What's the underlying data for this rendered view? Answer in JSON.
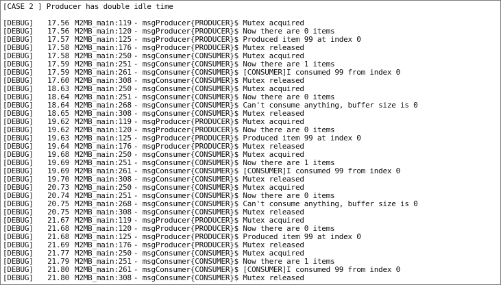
{
  "header": {
    "title": "[CASE 2 ] Producer has double idle time"
  },
  "log": [
    {
      "level": "[DEBUG]",
      "time": "17.56",
      "source": "M2MB_main:119",
      "message": "- msgProducer{PRODUCER}$ Mutex acquired"
    },
    {
      "level": "[DEBUG]",
      "time": "17.56",
      "source": "M2MB_main:120",
      "message": "- msgProducer{PRODUCER}$ Now there are 0 items"
    },
    {
      "level": "[DEBUG]",
      "time": "17.57",
      "source": "M2MB_main:125",
      "message": "- msgProducer{PRODUCER}$ Produced item 99 at index 0"
    },
    {
      "level": "[DEBUG]",
      "time": "17.58",
      "source": "M2MB_main:176",
      "message": "- msgProducer{PRODUCER}$ Mutex released"
    },
    {
      "level": "[DEBUG]",
      "time": "17.58",
      "source": "M2MB_main:250",
      "message": "- msgConsumer{CONSUMER}$ Mutex acquired"
    },
    {
      "level": "[DEBUG]",
      "time": "17.59",
      "source": "M2MB_main:251",
      "message": "- msgConsumer{CONSUMER}$ Now there are 1 items"
    },
    {
      "level": "[DEBUG]",
      "time": "17.59",
      "source": "M2MB_main:261",
      "message": "- msgConsumer{CONSUMER}$ [CONSUMER]I consumed 99 from index 0"
    },
    {
      "level": "[DEBUG]",
      "time": "17.60",
      "source": "M2MB_main:308",
      "message": "- msgConsumer{CONSUMER}$ Mutex released"
    },
    {
      "level": "[DEBUG]",
      "time": "18.63",
      "source": "M2MB_main:250",
      "message": "- msgConsumer{CONSUMER}$ Mutex acquired"
    },
    {
      "level": "[DEBUG]",
      "time": "18.64",
      "source": "M2MB_main:251",
      "message": "- msgConsumer{CONSUMER}$ Now there are 0 items"
    },
    {
      "level": "[DEBUG]",
      "time": "18.64",
      "source": "M2MB_main:268",
      "message": "- msgConsumer{CONSUMER}$ Can't consume anything, buffer size is 0"
    },
    {
      "level": "[DEBUG]",
      "time": "18.65",
      "source": "M2MB_main:308",
      "message": "- msgConsumer{CONSUMER}$ Mutex released"
    },
    {
      "level": "[DEBUG]",
      "time": "19.62",
      "source": "M2MB_main:119",
      "message": "- msgProducer{PRODUCER}$ Mutex acquired"
    },
    {
      "level": "[DEBUG]",
      "time": "19.62",
      "source": "M2MB_main:120",
      "message": "- msgProducer{PRODUCER}$ Now there are 0 items"
    },
    {
      "level": "[DEBUG]",
      "time": "19.63",
      "source": "M2MB_main:125",
      "message": "- msgProducer{PRODUCER}$ Produced item 99 at index 0"
    },
    {
      "level": "[DEBUG]",
      "time": "19.64",
      "source": "M2MB_main:176",
      "message": "- msgProducer{PRODUCER}$ Mutex released"
    },
    {
      "level": "[DEBUG]",
      "time": "19.68",
      "source": "M2MB_main:250",
      "message": "- msgConsumer{CONSUMER}$ Mutex acquired"
    },
    {
      "level": "[DEBUG]",
      "time": "19.69",
      "source": "M2MB_main:251",
      "message": "- msgConsumer{CONSUMER}$ Now there are 1 items"
    },
    {
      "level": "[DEBUG]",
      "time": "19.69",
      "source": "M2MB_main:261",
      "message": "- msgConsumer{CONSUMER}$ [CONSUMER]I consumed 99 from index 0"
    },
    {
      "level": "[DEBUG]",
      "time": "19.70",
      "source": "M2MB_main:308",
      "message": "- msgConsumer{CONSUMER}$ Mutex released"
    },
    {
      "level": "[DEBUG]",
      "time": "20.73",
      "source": "M2MB_main:250",
      "message": "- msgConsumer{CONSUMER}$ Mutex acquired"
    },
    {
      "level": "[DEBUG]",
      "time": "20.74",
      "source": "M2MB_main:251",
      "message": "- msgConsumer{CONSUMER}$ Now there are 0 items"
    },
    {
      "level": "[DEBUG]",
      "time": "20.75",
      "source": "M2MB_main:268",
      "message": "- msgConsumer{CONSUMER}$ Can't consume anything, buffer size is 0"
    },
    {
      "level": "[DEBUG]",
      "time": "20.75",
      "source": "M2MB_main:308",
      "message": "- msgConsumer{CONSUMER}$ Mutex released"
    },
    {
      "level": "[DEBUG]",
      "time": "21.67",
      "source": "M2MB_main:119",
      "message": "- msgProducer{PRODUCER}$ Mutex acquired"
    },
    {
      "level": "[DEBUG]",
      "time": "21.68",
      "source": "M2MB_main:120",
      "message": "- msgProducer{PRODUCER}$ Now there are 0 items"
    },
    {
      "level": "[DEBUG]",
      "time": "21.68",
      "source": "M2MB_main:125",
      "message": "- msgProducer{PRODUCER}$ Produced item 99 at index 0"
    },
    {
      "level": "[DEBUG]",
      "time": "21.69",
      "source": "M2MB_main:176",
      "message": "- msgProducer{PRODUCER}$ Mutex released"
    },
    {
      "level": "[DEBUG]",
      "time": "21.77",
      "source": "M2MB_main:250",
      "message": "- msgConsumer{CONSUMER}$ Mutex acquired"
    },
    {
      "level": "[DEBUG]",
      "time": "21.79",
      "source": "M2MB_main:251",
      "message": "- msgConsumer{CONSUMER}$ Now there are 1 items"
    },
    {
      "level": "[DEBUG]",
      "time": "21.80",
      "source": "M2MB_main:261",
      "message": "- msgConsumer{CONSUMER}$ [CONSUMER]I consumed 99 from index 0"
    },
    {
      "level": "[DEBUG]",
      "time": "21.80",
      "source": "M2MB_main:308",
      "message": "- msgConsumer{CONSUMER}$ Mutex released"
    }
  ]
}
